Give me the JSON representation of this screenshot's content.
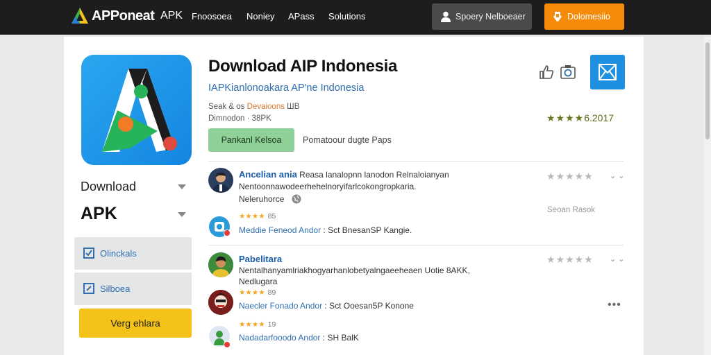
{
  "header": {
    "brand": "APPoneat",
    "brand_sub": "APK",
    "nav": [
      "Fnoosoea",
      "Noniey",
      "APass",
      "Solutions"
    ],
    "search_label": "Spoery Nelboeaer",
    "cta_label": "Dolomesiio"
  },
  "sidebar": {
    "download_label": "Download",
    "apk_label": "APK",
    "items": [
      {
        "label": "Olinckals",
        "icon": "checkbox-icon"
      },
      {
        "label": "Silboea",
        "icon": "edit-icon"
      }
    ],
    "action_button": "Verg ehlara"
  },
  "app": {
    "title": "Download AIP Indonesia",
    "subtitle": "IAPKianlonoakara AP'ne Indonesia",
    "meta_prefix": "Seak & os",
    "meta_dev": "Devaioons",
    "meta_suffix": "ШВ",
    "meta2": "Dimnodon · 38PK",
    "primary_button": "Pankanl Kelsoa",
    "secondary_text": "Pomatoour dugte Paps",
    "rating_stars": "★★★★",
    "rating_value": "6.2017",
    "colors": {
      "accent": "#1f8fe0",
      "cta": "#f58a0b",
      "primary_button": "#8fcf98",
      "action": "#f5c21a"
    }
  },
  "reviews": [
    {
      "name": "Ancelian ania",
      "text_tail": " Reasa lanalopnn lanodon Relnaloianyan",
      "text_line2": "Nentoonnawodeerhehelnoryifarlcokongropkaria.",
      "text_line3": "Neleruhorce",
      "stars_grey": "★★★★★",
      "note": "Seoan Rasok",
      "sub_stars": "★★★★",
      "sub_count": "85",
      "sub_name": "Meddie Feneod Andor",
      "sub_rest": " : Sct BnesanSP Kangie."
    },
    {
      "name": "Pabelitara",
      "text_line1": "Nentalhanyamlriakhogyarhanlobetyalngaeeheaen Uotie 8AKK,",
      "text_line2": "Nedlugara",
      "stars_grey": "★★★★★",
      "sub_stars": "★★★★",
      "sub_count": "89",
      "sub_name": "Naecler Fonado Andor",
      "sub_rest": " : Sct Ooesan5P Konone"
    },
    {
      "sub_stars": "★★★★",
      "sub_count": "19",
      "sub_name": "Nadadarfooodo Andor",
      "sub_rest": " : SH BalK"
    }
  ],
  "chevron": "⌄ ⌄",
  "more_dots": "•••"
}
